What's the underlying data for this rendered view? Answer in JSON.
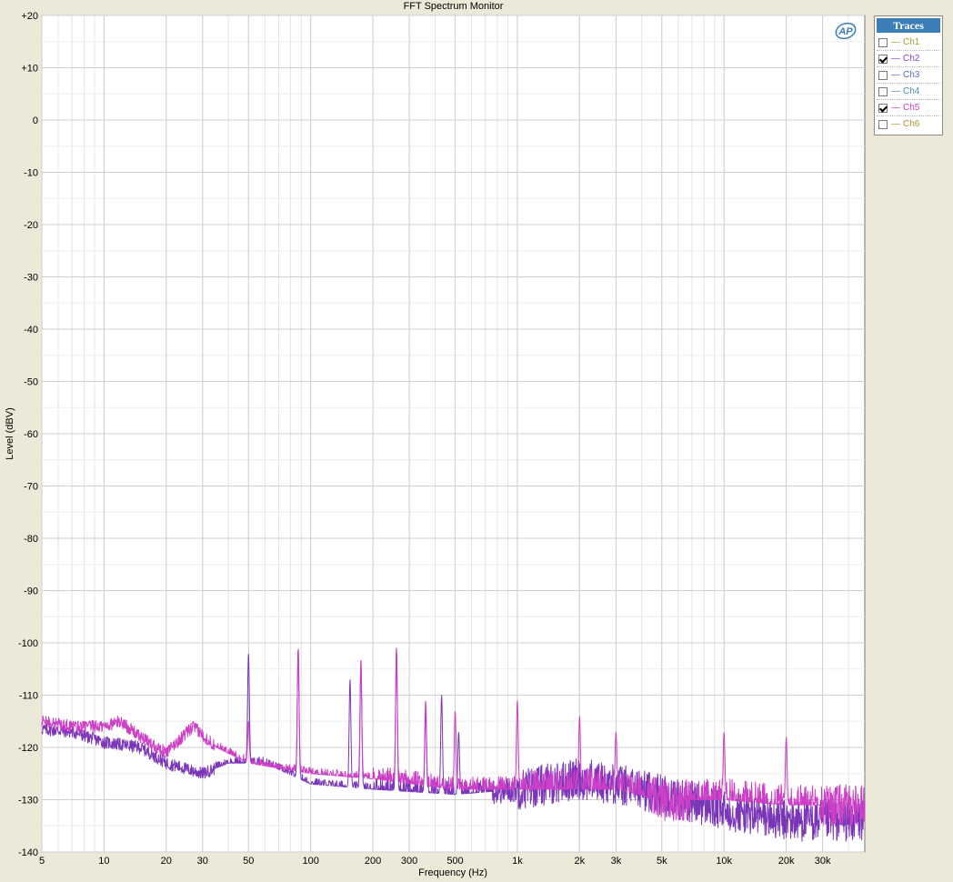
{
  "window": {
    "title": "FFT Spectrum Monitor"
  },
  "legend": {
    "header": "Traces",
    "items": [
      {
        "label": "Ch1",
        "checked": false,
        "color": "#a89a2a"
      },
      {
        "label": "Ch2",
        "checked": true,
        "color": "#8a3fc8"
      },
      {
        "label": "Ch3",
        "checked": false,
        "color": "#5a6ec0"
      },
      {
        "label": "Ch4",
        "checked": false,
        "color": "#4a8fb0"
      },
      {
        "label": "Ch5",
        "checked": true,
        "color": "#d040c8"
      },
      {
        "label": "Ch6",
        "checked": false,
        "color": "#b0903a"
      }
    ]
  },
  "logo": {
    "text": "AP",
    "color": "#3a7cc0"
  },
  "chart_data": {
    "type": "line",
    "title": "FFT Spectrum Monitor",
    "xlabel": "Frequency (Hz)",
    "ylabel": "Level (dBV)",
    "xscale": "log",
    "xlim": [
      5,
      48000
    ],
    "ylim": [
      -140,
      20
    ],
    "grid": true,
    "legend_position": "top-right",
    "x_ticks": [
      5,
      10,
      20,
      30,
      50,
      100,
      200,
      300,
      500,
      1000,
      2000,
      3000,
      5000,
      10000,
      20000,
      30000
    ],
    "x_tick_labels": [
      "5",
      "10",
      "20",
      "30",
      "50",
      "100",
      "200",
      "300",
      "500",
      "1k",
      "2k",
      "3k",
      "5k",
      "10k",
      "20k",
      "30k"
    ],
    "y_ticks": [
      20,
      10,
      0,
      -10,
      -20,
      -30,
      -40,
      -50,
      -60,
      -70,
      -80,
      -90,
      -100,
      -110,
      -120,
      -130,
      -140
    ],
    "y_tick_labels": [
      "+20",
      "+10",
      "0",
      "-10",
      "-20",
      "-30",
      "-40",
      "-50",
      "-60",
      "-70",
      "-80",
      "-90",
      "-100",
      "-110",
      "-120",
      "-130",
      "-140"
    ],
    "series": [
      {
        "name": "Ch2",
        "color": "#7a35b8",
        "peaks": [
          [
            50,
            -102
          ],
          [
            87,
            -101
          ],
          [
            155,
            -107
          ],
          [
            175,
            -104
          ],
          [
            260,
            -101
          ],
          [
            360,
            -113
          ],
          [
            430,
            -110
          ],
          [
            520,
            -117
          ]
        ],
        "floor": [
          [
            5,
            -116.5
          ],
          [
            7,
            -117
          ],
          [
            10,
            -119
          ],
          [
            15,
            -120
          ],
          [
            20,
            -123
          ],
          [
            30,
            -125
          ],
          [
            40,
            -123
          ],
          [
            60,
            -123
          ],
          [
            100,
            -127
          ],
          [
            200,
            -128
          ],
          [
            500,
            -129
          ],
          [
            1000,
            -128
          ],
          [
            2000,
            -126
          ],
          [
            3000,
            -127
          ],
          [
            5000,
            -129
          ],
          [
            10000,
            -132
          ],
          [
            20000,
            -134
          ],
          [
            48000,
            -134
          ]
        ]
      },
      {
        "name": "Ch5",
        "color": "#cc3fc6",
        "peaks": [
          [
            50,
            -115
          ],
          [
            87,
            -101
          ],
          [
            175,
            -103
          ],
          [
            260,
            -101
          ],
          [
            360,
            -111
          ],
          [
            500,
            -113
          ],
          [
            1000,
            -111
          ],
          [
            2000,
            -114
          ],
          [
            3000,
            -117
          ],
          [
            10000,
            -117
          ],
          [
            20000,
            -118
          ]
        ],
        "floor": [
          [
            5,
            -115
          ],
          [
            7,
            -116
          ],
          [
            10,
            -116
          ],
          [
            12,
            -115
          ],
          [
            15,
            -118
          ],
          [
            20,
            -121
          ],
          [
            27,
            -116
          ],
          [
            35,
            -120
          ],
          [
            50,
            -123
          ],
          [
            100,
            -125
          ],
          [
            200,
            -126
          ],
          [
            500,
            -128
          ],
          [
            1000,
            -128
          ],
          [
            2000,
            -128
          ],
          [
            3000,
            -128
          ],
          [
            5000,
            -130
          ],
          [
            10000,
            -130
          ],
          [
            20000,
            -131
          ],
          [
            48000,
            -131
          ]
        ]
      }
    ]
  }
}
